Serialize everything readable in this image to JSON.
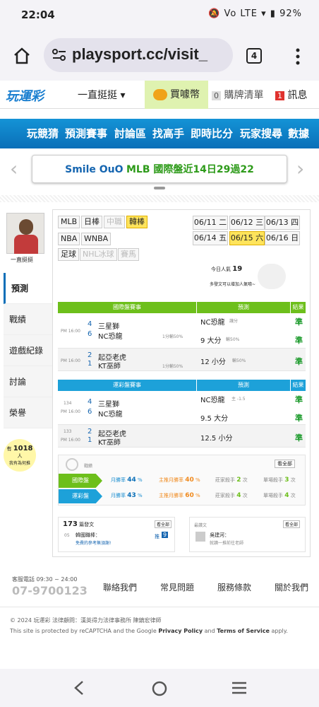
{
  "status": {
    "time": "22:04",
    "icons": "🔕 Vo LTE ▾ ▮ 92%"
  },
  "browser": {
    "url": "playsport.cc/visit_",
    "tabs": "4"
  },
  "topnav": {
    "logo": "玩運彩",
    "user": "一直挺挺",
    "coin": "買噱幣",
    "cart_count": "0",
    "cart": "購牌清單",
    "msg_count": "1",
    "msg": "訊息"
  },
  "menu": [
    "玩競猜",
    "預測賽事",
    "討論區",
    "找高手",
    "即時比分",
    "玩家搜尋",
    "數據"
  ],
  "notice": {
    "name": "Smile OuO",
    "text": "MLB 國際盤近14日29過22"
  },
  "sidebar": {
    "name": "一直挺挺",
    "items": [
      "預測",
      "戰績",
      "遊戲紀錄",
      "討論",
      "榮譽"
    ],
    "count_label": "有",
    "count": "1018",
    "count_unit": "人",
    "count_sub": "我有為何推"
  },
  "leagues": [
    "MLB",
    "日棒",
    "中職",
    "韓棒",
    "NBA",
    "WNBA",
    "足球",
    "NHL冰球",
    "賽馬"
  ],
  "dates": [
    "06/11 二",
    "06/12 三",
    "06/13 四",
    "06/14 五",
    "06/15 六",
    "06/16 日"
  ],
  "popularity": {
    "label": "今日人氣",
    "value": "19",
    "note": "多發文可以增加人氣唷~"
  },
  "intl": {
    "header": "國際盤賽事",
    "pred": "預測",
    "result": "結果",
    "rows": [
      {
        "time": "PM 16:00",
        "n1": "4",
        "n2": "6",
        "t1": "三星獅",
        "t2": "NC恐龍",
        "tag": "主",
        "line": "1分輸50%",
        "pick": "NC恐龍",
        "pick_note": "讓分",
        "res": "準"
      },
      {
        "pick": "9 大分",
        "pick_note": "輸50%",
        "res": "準"
      },
      {
        "time": "PM 16:00",
        "n1": "2",
        "n2": "1",
        "t1": "起亞老虎",
        "t2": "KT巫師",
        "tag": "主",
        "line": "1分輸50%",
        "pick": "12 小分",
        "pick_note": "輸50%",
        "res": "準"
      }
    ]
  },
  "taiwan": {
    "header": "運彩盤賽事",
    "pred": "預測",
    "result": "結果",
    "rows": [
      {
        "no": "134",
        "time": "PM 16:00",
        "n1": "4",
        "n2": "6",
        "t1": "三星獅",
        "t2": "NC恐龍",
        "tag": "主",
        "pick": "NC恐龍",
        "pick_note": "主 -1.5",
        "res": "準"
      },
      {
        "pick": "9.5 大分",
        "res": "準"
      },
      {
        "no": "133",
        "time": "PM 16:00",
        "n1": "2",
        "n2": "1",
        "t1": "起亞老虎",
        "t2": "KT巫師",
        "tag": "主",
        "pick": "12.5 小分",
        "res": "準"
      }
    ]
  },
  "record": {
    "title": "戰績",
    "more": "看全部",
    "rows": [
      {
        "label": "國際盤",
        "m": "月勝率",
        "mv": "44",
        "h": "主推月勝率",
        "hv": "40",
        "s": "莊家殺手",
        "sv": "2",
        "u": "次",
        "sk": "單場殺手",
        "skv": "3"
      },
      {
        "label": "運彩盤",
        "m": "月勝率",
        "mv": "43",
        "h": "主推月勝率",
        "hv": "60",
        "s": "莊家殺手",
        "sv": "4",
        "u": "次",
        "sk": "單場殺手",
        "skv": "4"
      }
    ]
  },
  "posts": {
    "count": "173",
    "label": "篇發文",
    "more": "看全部",
    "item_date": "05",
    "item_title": "韓國職棒：",
    "item_sub": "免費的參考無須謝!",
    "item_tag": "推",
    "item_num": "9"
  },
  "replies": {
    "label": "最讚文",
    "more": "看全部",
    "author": "吳建河：",
    "sub": "就讀一推前往老師"
  },
  "footer": {
    "phone_label": "客服電話 09:30 ~ 24:00",
    "phone": "07-9700123",
    "links": [
      "聯絡我們",
      "常見問題",
      "服務條款",
      "關於我們"
    ],
    "copy": "© 2024 玩運彩 法律顧問：漢英得力法律事務所 陳鎮宏律師",
    "recaptcha": "This site is protected by reCAPTCHA and the Google",
    "pp": "Privacy Policy",
    "and": "and",
    "tos": "Terms of Service",
    "apply": "apply."
  },
  "colors": {
    "green": "#6dbf1b",
    "blue": "#1da1d9",
    "brand": "#1a7fd0"
  }
}
